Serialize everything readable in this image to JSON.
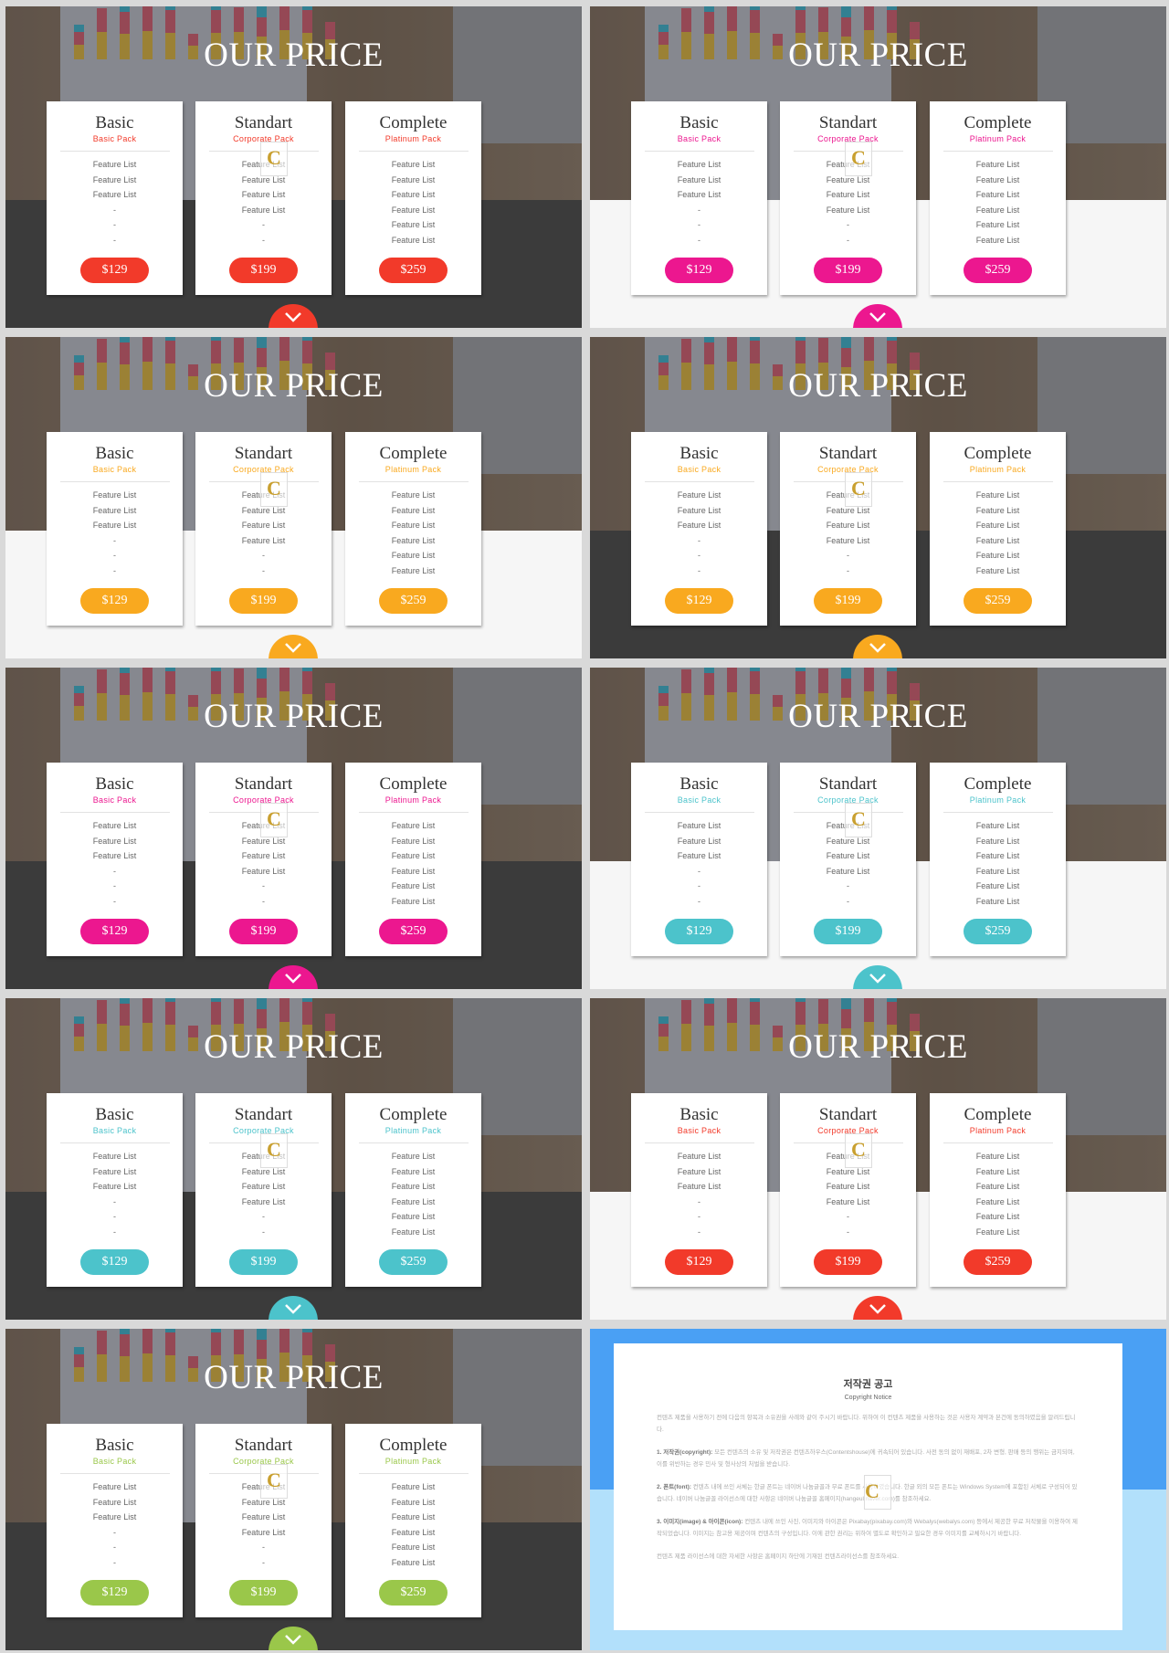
{
  "colors": {
    "red": "#f23a2a",
    "magenta": "#ec178f",
    "orange": "#f9a91f",
    "teal": "#4cc3cb",
    "green": "#9ac74a",
    "dark": "#3b3b3b"
  },
  "pricing": {
    "title": "OUR PRICE",
    "cards": [
      {
        "name": "Basic",
        "sub": "Basic  Pack",
        "features": [
          "Feature  List",
          "Feature  List",
          "Feature  List",
          "-",
          "-",
          "-"
        ],
        "price": "$129"
      },
      {
        "name": "Standart",
        "sub": "Corporate  Pack",
        "features": [
          "Feature  List",
          "Feature  List",
          "Feature  List",
          "Feature  List",
          "-",
          "-"
        ],
        "price": "$199"
      },
      {
        "name": "Complete",
        "sub": "Platinum  Pack",
        "features": [
          "Feature  List",
          "Feature  List",
          "Feature  List",
          "Feature  List",
          "Feature  List",
          "Feature  List"
        ],
        "price": "$259"
      }
    ],
    "next_icon": "chevron-down-icon"
  },
  "slides": [
    {
      "bottom": "dark",
      "accent": "#f23a2a"
    },
    {
      "bottom": "white",
      "accent": "#ec178f"
    },
    {
      "bottom": "white",
      "accent": "#f9a91f"
    },
    {
      "bottom": "dark",
      "accent": "#f9a91f"
    },
    {
      "bottom": "dark",
      "accent": "#ec178f"
    },
    {
      "bottom": "white",
      "accent": "#4cc3cb"
    },
    {
      "bottom": "dark",
      "accent": "#4cc3cb"
    },
    {
      "bottom": "white",
      "accent": "#f23a2a"
    },
    {
      "bottom": "dark",
      "accent": "#9ac74a"
    }
  ],
  "copyright": {
    "title": "저작권 공고",
    "subtitle": "Copyright Notice",
    "intro": "컨텐츠 제품을 사용하기 전에 다음의 항목과 소유권을 사례와 같이 주시기 바랍니다. 위하여 이 컨텐츠 제품을 사용하는 것은 사용자 계약과 본건에 동의하였음을 알려드립니다.",
    "items": [
      {
        "head": "1. 저작권(copyright):",
        "body": "모든 컨텐츠의 소유 및 저작권은 컨텐츠하우스(Contentshouse)에 귀속되어 있습니다. 사전 동의 없이 재배포, 2차 변형, 판매 등의 행위는 금지되며, 이를 위반하는 경우 민사 및 형사상의 처벌을 받습니다."
      },
      {
        "head": "2. 폰트(font):",
        "body": "컨텐츠 내에 쓰인 서체는 한글 폰트는 네이버 나눔글꼴과 무료 폰트를 사용하였습니다. 한글 외의 모든 폰트는 Windows System에 포함된 서체로 구성되어 있습니다. 네이버 나눔글꼴 라이선스에 대한 사항은 네이버 나눔글꼴 홈페이지(hangeul.naver.com)를 참조하세요."
      },
      {
        "head": "3. 이미지(image) & 아이콘(icon):",
        "body": "컨텐츠 내에 쓰인 사진, 이미지와 아이콘은 Pixabay(pixabay.com)와 Webalys(webalys.com) 등에서 제공한 무료 저작물을 이용하여 제작되었습니다. 이미지는 참고용 제공이며 컨텐츠의 구성입니다. 이에 관한 권리는 위하여 별도로 확인하고 필요한 경우 이미지를 교체하시기 바랍니다."
      }
    ],
    "footer": "컨텐츠 제품 라이선스에 대한 자세한 사항은 홈페이지 하단에 기재된 컨텐츠라이선스를 참조하세요."
  }
}
